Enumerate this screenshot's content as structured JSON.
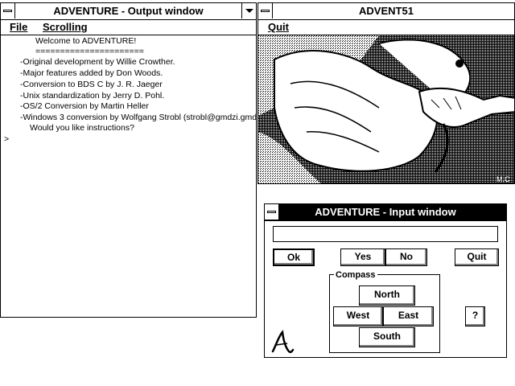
{
  "output_window": {
    "title": "ADVENTURE - Output window",
    "menu": {
      "file": "File",
      "scrolling": "Scrolling"
    },
    "lines": [
      "Welcome to ADVENTURE!",
      "======================",
      "-Original development by Willie Crowther.",
      "-Major features added by Don Woods.",
      "-Conversion to BDS  C by J. R. Jaeger",
      "-Unix standardization by Jerry D. Pohl.",
      "-OS/2 Conversion by Martin Heller",
      "-Windows 3 conversion by Wolfgang Strobl (strobl@gmdzi.gmd",
      "Would you like instructions?"
    ],
    "prompt": ">"
  },
  "image_window": {
    "title": "ADVENT51",
    "menu": {
      "quit": "Quit"
    },
    "signature": "M.C"
  },
  "input_window": {
    "title": "ADVENTURE - Input window",
    "command_value": "",
    "buttons": {
      "ok": "Ok",
      "yes": "Yes",
      "no": "No",
      "quit": "Quit",
      "help": "?"
    },
    "compass": {
      "label": "Compass",
      "north": "North",
      "west": "West",
      "east": "East",
      "south": "South"
    },
    "logo_letter": "A"
  }
}
